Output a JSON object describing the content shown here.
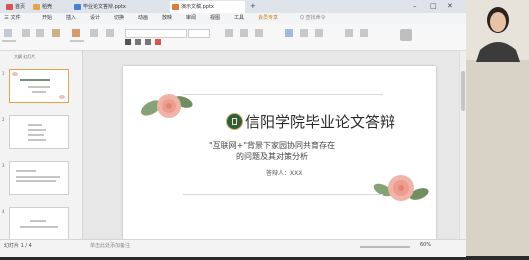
{
  "window": {
    "tabs": [
      {
        "label": "首页",
        "color": "#d9534f"
      },
      {
        "label": "稻壳",
        "color": "#e8a24a"
      },
      {
        "label": "毕业论文答辩.pptx",
        "color": "#4a7fd6"
      },
      {
        "label": "演示文稿.pptx",
        "color": "#e07b39"
      }
    ]
  },
  "menu": {
    "items": [
      "三 文件",
      "开始",
      "插入",
      "设计",
      "切换",
      "动画",
      "放映",
      "审阅",
      "视图",
      "工具",
      "会员专享"
    ],
    "search_placeholder": "Q 查找命令"
  },
  "thumbnails": {
    "tab_label": "大纲  幻灯片",
    "slides": [
      "1",
      "2",
      "3",
      "4"
    ]
  },
  "slide": {
    "title": "信阳学院毕业论文答辩",
    "subtitle_line1": "\"互联网+\"背景下家园协同共育存在",
    "subtitle_line2": "的问题及其对策分析",
    "presenter": "答辩人：XXX"
  },
  "status": {
    "left": "幻灯片 1 / 4",
    "notes": "单击此处添加备注",
    "zoom": "60%"
  },
  "colors": {
    "accent": "#e8a24a",
    "slide_title": "#2a2a2a",
    "rose": "#f1b3a6",
    "leaf": "#6f8f5f",
    "emblem": "#2e5e3a"
  }
}
